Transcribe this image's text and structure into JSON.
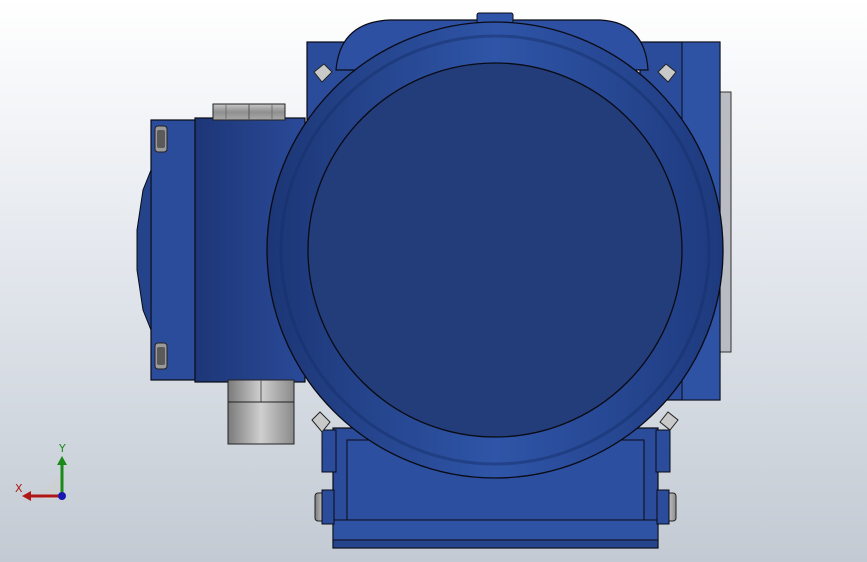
{
  "viewport": {
    "background_top": "#ffffff",
    "background_bottom": "#c3cad3"
  },
  "model": {
    "body_color": "#2a4c9a",
    "body_dark": "#1f3a78",
    "face_color": "#223d7a",
    "metal_color": "#9a9a9a",
    "outline_color": "#0a0a14"
  },
  "triad": {
    "x_label": "X",
    "y_label": "Y",
    "x_color": "#b01818",
    "y_color": "#1a8a1a",
    "z_color": "#1818b0"
  }
}
